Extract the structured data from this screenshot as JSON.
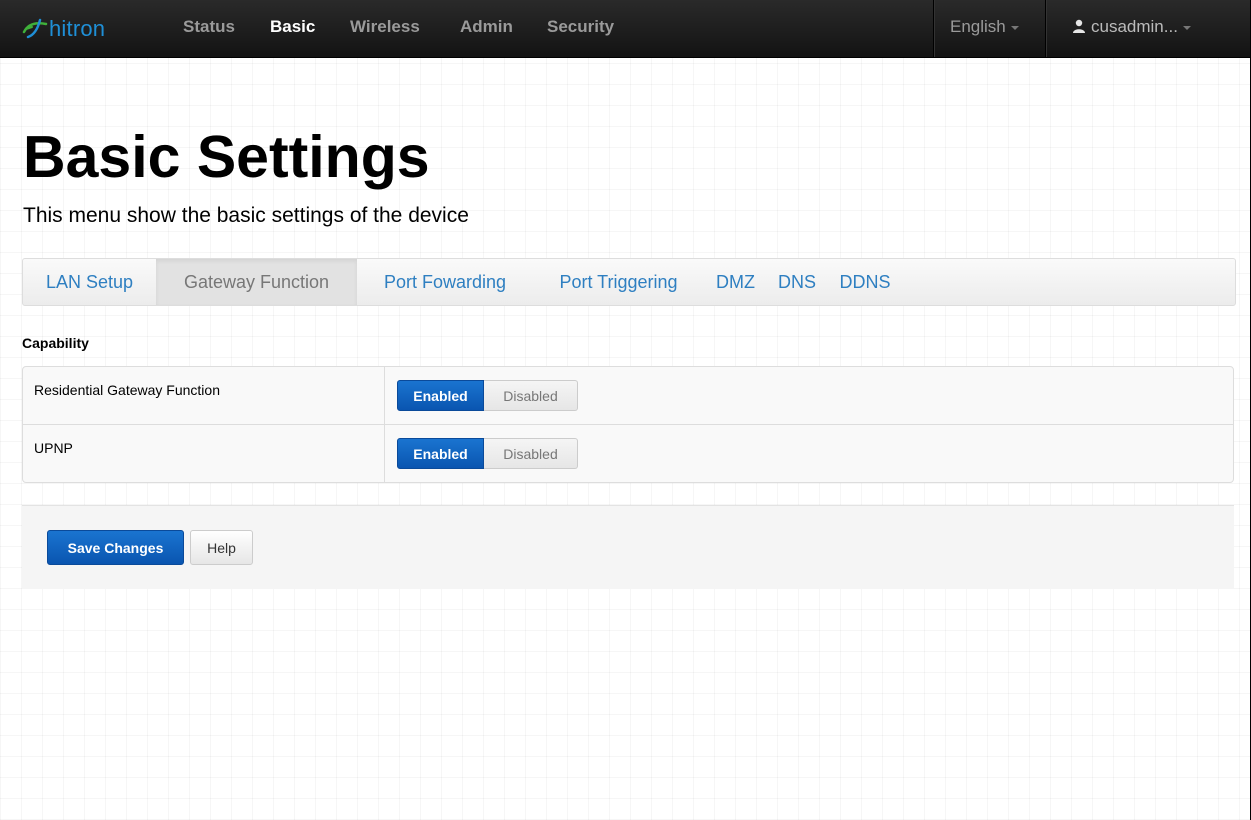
{
  "navbar": {
    "logo_text": "hitron",
    "items": [
      {
        "label": "Status",
        "active": false
      },
      {
        "label": "Basic",
        "active": true
      },
      {
        "label": "Wireless",
        "active": false
      },
      {
        "label": "Admin",
        "active": false
      },
      {
        "label": "Security",
        "active": false
      }
    ],
    "language": "English",
    "user": "cusadmin..."
  },
  "page": {
    "title": "Basic Settings",
    "subtitle": "This menu show the basic settings of the device"
  },
  "tabs": [
    {
      "label": "LAN Setup",
      "active": false
    },
    {
      "label": "Gateway Function",
      "active": true
    },
    {
      "label": "Port Fowarding",
      "active": false
    },
    {
      "label": "Port Triggering",
      "active": false
    },
    {
      "label": "DMZ",
      "active": false
    },
    {
      "label": "DNS",
      "active": false
    },
    {
      "label": "DDNS",
      "active": false
    }
  ],
  "capability": {
    "section_label": "Capability",
    "rows": [
      {
        "label": "Residential Gateway Function",
        "enabled_label": "Enabled",
        "disabled_label": "Disabled",
        "selected": "Enabled"
      },
      {
        "label": "UPNP",
        "enabled_label": "Enabled",
        "disabled_label": "Disabled",
        "selected": "Enabled"
      }
    ]
  },
  "actions": {
    "save_label": "Save Changes",
    "help_label": "Help"
  },
  "colors": {
    "accent": "#0a5fc0",
    "link": "#2e7fc1",
    "navbar_bg": "#1b1b1b"
  }
}
